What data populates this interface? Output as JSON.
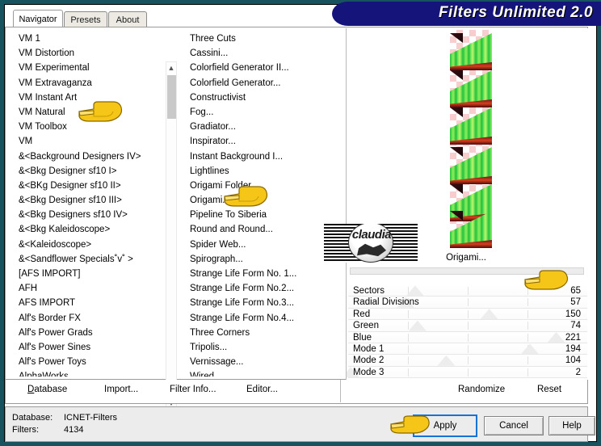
{
  "window": {
    "title": "Filters Unlimited 2.0"
  },
  "tabs": [
    {
      "label": "Navigator",
      "active": true
    },
    {
      "label": "Presets",
      "active": false
    },
    {
      "label": "About",
      "active": false
    }
  ],
  "categories": {
    "selected": "VM Instant Art",
    "items": [
      "VM 1",
      "VM Distortion",
      "VM Experimental",
      "VM Extravaganza",
      "VM Instant Art",
      "VM Natural",
      "VM Toolbox",
      "VM",
      "&<Background Designers IV>",
      "&<Bkg Designer sf10 I>",
      "&<BKg Designer sf10 II>",
      "&<Bkg Designer sf10 III>",
      "&<Bkg Designers sf10 IV>",
      "&<Bkg Kaleidoscope>",
      "&<Kaleidoscope>",
      "&<Sandflower Specials˚v˚ >",
      "[AFS IMPORT]",
      "AFH",
      "AFS IMPORT",
      "Alf's Border FX",
      "Alf's Power Grads",
      "Alf's Power Sines",
      "Alf's Power Toys",
      "AlphaWorks"
    ]
  },
  "filters": {
    "selected": "Origami...",
    "items": [
      "Three Cuts",
      "Cassini...",
      "Colorfield Generator II...",
      "Colorfield Generator...",
      "Constructivist",
      "Fog...",
      "Gradiator...",
      "Inspirator...",
      "Instant Background I...",
      "Lightlines",
      "Origami Folder...",
      "Origami...",
      "Pipeline To Siberia",
      "Round and Round...",
      "Spider Web...",
      "Spirograph...",
      "Strange Life Form No. 1...",
      "Strange Life Form No.2...",
      "Strange Life Form No.3...",
      "Strange Life Form No.4...",
      "Three Corners",
      "Tripolis...",
      "Vernissage...",
      "Wired"
    ]
  },
  "preview": {
    "caption": "Origami..."
  },
  "watermark": {
    "text": "claudia"
  },
  "parameters": [
    {
      "label": "Sectors",
      "value": "65",
      "pos": 28
    },
    {
      "label": "Radial Divisions",
      "value": "57",
      "pos": 24
    },
    {
      "label": "Red",
      "value": "150",
      "pos": 59
    },
    {
      "label": "Green",
      "value": "74",
      "pos": 29
    },
    {
      "label": "Blue",
      "value": "221",
      "pos": 87
    },
    {
      "label": "Mode 1",
      "value": "194",
      "pos": 76
    },
    {
      "label": "Mode 2",
      "value": "104",
      "pos": 41
    },
    {
      "label": "Mode 3",
      "value": "2",
      "pos": 1
    }
  ],
  "toolbar": {
    "left": [
      {
        "label": "Database",
        "accel": "D"
      },
      {
        "label": "Import...",
        "accel": "m"
      },
      {
        "label": "Filter Info...",
        "accel": "I"
      },
      {
        "label": "Editor...",
        "accel": "E"
      }
    ],
    "right": [
      {
        "label": "Randomize"
      },
      {
        "label": "Reset"
      }
    ]
  },
  "status": {
    "database_label": "Database:",
    "database_value": "ICNET-Filters",
    "filters_label": "Filters:",
    "filters_value": "4134"
  },
  "buttons": {
    "apply": "Apply",
    "cancel": "Cancel",
    "help": "Help"
  },
  "colors": {
    "window_border": "#17525f",
    "title_bg": "#14147a",
    "selection_blue": "#0a5fd4",
    "selection_gray": "#e4e4e4",
    "focus_blue": "#1673d6",
    "hand_yellow": "#f5c518"
  }
}
